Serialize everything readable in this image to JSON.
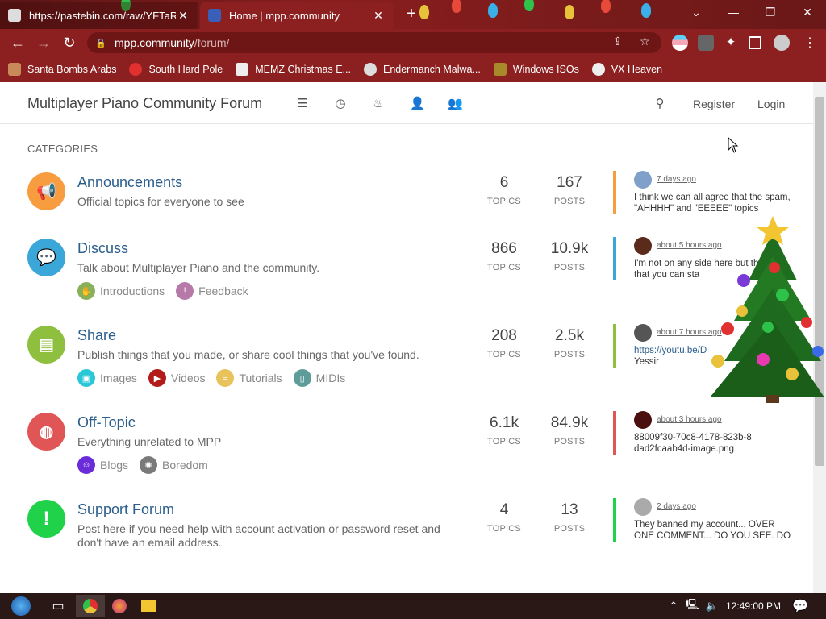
{
  "browser": {
    "tabs": [
      {
        "title": "https://pastebin.com/raw/YFTaR",
        "active": false
      },
      {
        "title": "Home | mpp.community",
        "active": true
      }
    ],
    "url_host": "mpp.community",
    "url_path": "/forum/",
    "bookmarks": [
      {
        "label": "Santa Bombs Arabs"
      },
      {
        "label": "South Hard Pole"
      },
      {
        "label": "MEMZ Christmas E..."
      },
      {
        "label": "Endermanch Malwa..."
      },
      {
        "label": "Windows ISOs"
      },
      {
        "label": "VX Heaven"
      }
    ]
  },
  "site": {
    "title": "Multiplayer Piano Community Forum",
    "nav_icons": [
      "list-icon",
      "clock-icon",
      "fire-icon",
      "user-icon",
      "group-icon"
    ],
    "search_icon": "search-icon",
    "register_label": "Register",
    "login_label": "Login"
  },
  "categories_heading": "CATEGORIES",
  "categories": [
    {
      "name": "Announcements",
      "description": "Official topics for everyone to see",
      "icon": "megaphone-icon",
      "color": "#f79d3f",
      "topics": "6",
      "topics_label": "TOPICS",
      "posts": "167",
      "posts_label": "POSTS",
      "subcategories": [],
      "last_post": {
        "when": "7 days ago",
        "text": "I think we can all agree that the spam, \"AHHHH\" and \"EEEEE\" topics",
        "avatar_color": "#7fa0c8"
      }
    },
    {
      "name": "Discuss",
      "description": "Talk about Multiplayer Piano and the community.",
      "icon": "comments-icon",
      "color": "#3aa7d8",
      "topics": "866",
      "topics_label": "TOPICS",
      "posts": "10.9k",
      "posts_label": "POSTS",
      "subcategories": [
        {
          "label": "Introductions",
          "color": "#8ab05a"
        },
        {
          "label": "Feedback",
          "color": "#b77aa8"
        }
      ],
      "last_post": {
        "when": "about 5 hours ago",
        "text": "I'm not on any side here but the fact that you can sta",
        "avatar_color": "#5a2a1a"
      }
    },
    {
      "name": "Share",
      "description": "Publish things that you made, or share cool things that you've found.",
      "icon": "newspaper-icon",
      "color": "#8fbf3f",
      "topics": "208",
      "topics_label": "TOPICS",
      "posts": "2.5k",
      "posts_label": "POSTS",
      "subcategories": [
        {
          "label": "Images",
          "color": "#2ac7d6"
        },
        {
          "label": "Videos",
          "color": "#b31b1b"
        },
        {
          "label": "Tutorials",
          "color": "#e8c25a"
        },
        {
          "label": "MIDIs",
          "color": "#5e9c9a"
        }
      ],
      "last_post": {
        "when": "about 7 hours ago",
        "text": "https://youtu.be/D",
        "text2": "Yessir",
        "avatar_color": "#555555"
      }
    },
    {
      "name": "Off-Topic",
      "description": "Everything unrelated to MPP",
      "icon": "globe-icon",
      "color": "#e05656",
      "topics": "6.1k",
      "topics_label": "TOPICS",
      "posts": "84.9k",
      "posts_label": "POSTS",
      "subcategories": [
        {
          "label": "Blogs",
          "color": "#6a2bd8"
        },
        {
          "label": "Boredom",
          "color": "#7a7a7a"
        }
      ],
      "last_post": {
        "when": "about 3 hours ago",
        "text": "88009f30-70c8-4178-823b-8dad2fcaab4d-image.png",
        "avatar_color": "#4a1010"
      }
    },
    {
      "name": "Support Forum",
      "description": "Post here if you need help with account activation or password reset and don't have an email address.",
      "icon": "exclamation-icon",
      "color": "#1fd24a",
      "topics": "4",
      "topics_label": "TOPICS",
      "posts": "13",
      "posts_label": "POSTS",
      "subcategories": [],
      "last_post": {
        "when": "2 days ago",
        "text": "They banned my account... OVER ONE COMMENT... DO YOU SEE. DO",
        "avatar_color": "#aaaaaa"
      }
    }
  ],
  "taskbar": {
    "clock": "12:49:00 PM"
  }
}
